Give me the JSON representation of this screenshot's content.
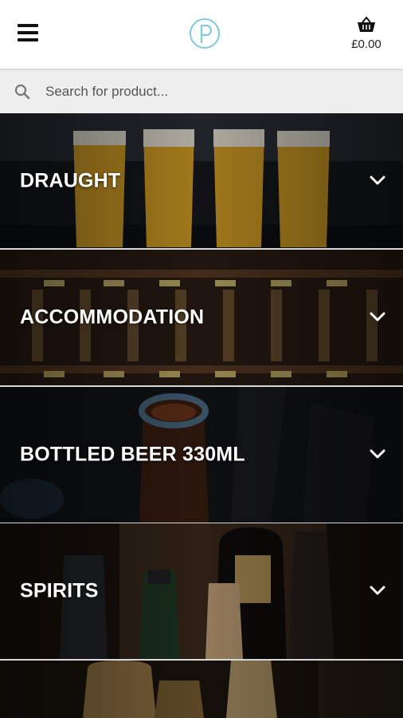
{
  "header": {
    "cart_total": "£0.00"
  },
  "search": {
    "placeholder": "Search for product..."
  },
  "categories": [
    {
      "label": "DRAUGHT"
    },
    {
      "label": "ACCOMMODATION"
    },
    {
      "label": "BOTTLED BEER 330ML"
    },
    {
      "label": "SPIRITS"
    },
    {
      "label": ""
    }
  ],
  "colors": {
    "logo_accent": "#7fc9e0",
    "search_bg": "#eeeeee"
  },
  "icons": [
    "menu-icon",
    "logo-icon",
    "basket-icon",
    "search-icon",
    "chevron-down-icon"
  ]
}
